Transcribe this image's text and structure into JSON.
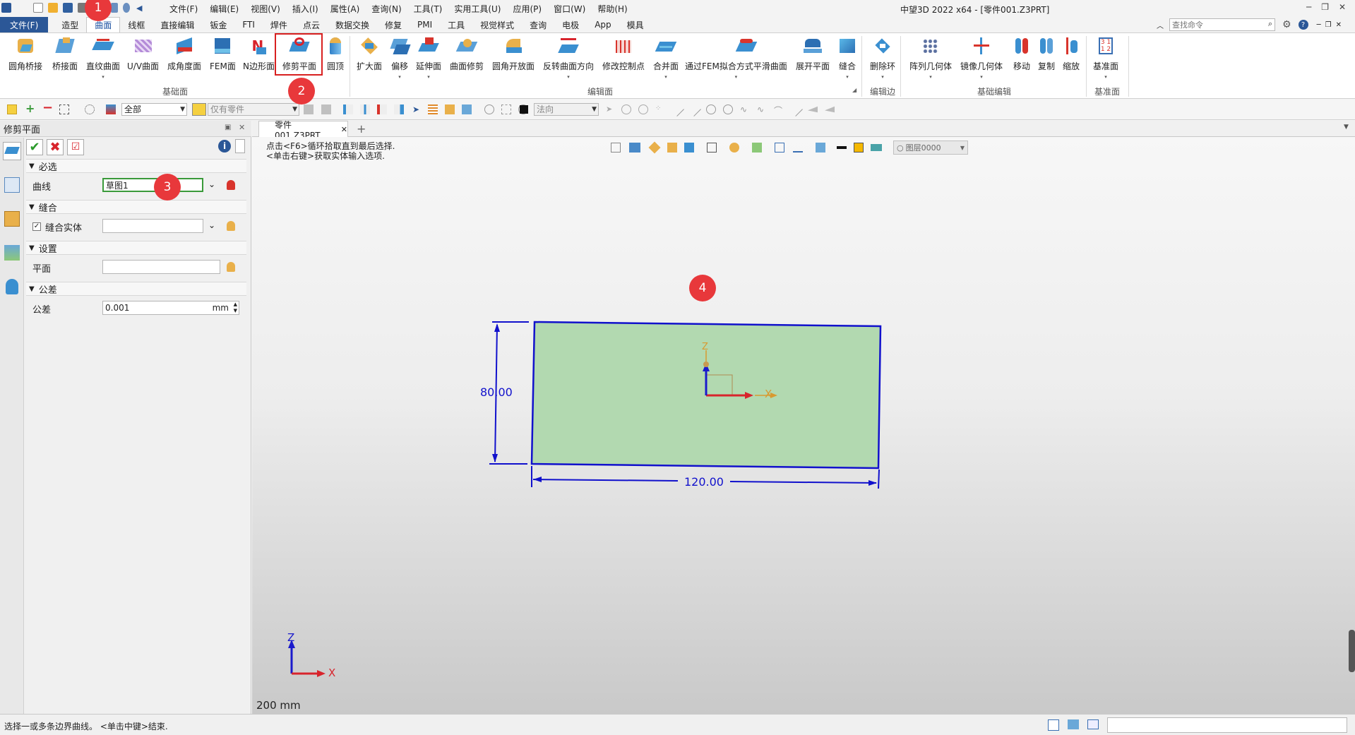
{
  "title": {
    "app": "中望3D 2022 x64 - [零件001.Z3PRT]",
    "menu": [
      "文件(F)",
      "编辑(E)",
      "视图(V)",
      "插入(I)",
      "属性(A)",
      "查询(N)",
      "工具(T)",
      "实用工具(U)",
      "应用(P)",
      "窗口(W)",
      "帮助(H)"
    ],
    "search_placeholder": "查找命令"
  },
  "ribbon_tabs": [
    "文件(F)",
    "造型",
    "曲面",
    "线框",
    "直接编辑",
    "钣金",
    "FTI",
    "焊件",
    "点云",
    "数据交换",
    "修复",
    "PMI",
    "工具",
    "视觉样式",
    "查询",
    "电极",
    "App",
    "模具"
  ],
  "ribbon": {
    "basic_surface": [
      "圆角桥接",
      "桥接面",
      "直纹曲面",
      "U/V曲面",
      "成角度面",
      "FEM面",
      "N边形面",
      "修剪平面",
      "圆顶"
    ],
    "basic_surface_label": "基础面",
    "edit_surface": [
      "扩大面",
      "偏移",
      "延伸面",
      "曲面修剪",
      "圆角开放面",
      "反转曲面方向",
      "修改控制点",
      "合并面",
      "通过FEM拟合方式平滑曲面",
      "展开平面",
      "缝合"
    ],
    "edit_surface_label": "编辑面",
    "edit_edge": [
      "删除环"
    ],
    "edit_edge_label": "编辑边",
    "basic_edit": [
      "阵列几何体",
      "镜像几何体",
      "移动",
      "复制",
      "缩放"
    ],
    "basic_edit_label": "基础编辑",
    "datum": [
      "基准面"
    ],
    "datum_label": "基准面"
  },
  "toolbar2": {
    "filter": "全部",
    "scope": "仅有零件",
    "normal": "法向"
  },
  "panel": {
    "title": "修剪平面",
    "section_required": "必选",
    "curve_label": "曲线",
    "curve_value": "草图1",
    "section_stitch": "缝合",
    "stitch_label": "缝合实体",
    "stitch_value": "",
    "section_settings": "设置",
    "plane_label": "平面",
    "plane_value": "",
    "section_tolerance": "公差",
    "tol_label": "公差",
    "tol_value": "0.001",
    "tol_unit": "mm"
  },
  "doc_tab": "零件001.Z3PRT",
  "hint_line1": "点击<F6>循环拾取直到最后选择.",
  "hint_line2": "<单击右键>获取实体输入选项.",
  "layer": "图层0000",
  "dims": {
    "height": "80.00",
    "width": "120.00"
  },
  "axes": {
    "x": "X",
    "z": "Z"
  },
  "scale": "200 mm",
  "status_text": "选择一或多条边界曲线。 <单击中键>结束.",
  "badges": [
    "1",
    "2",
    "3",
    "4"
  ],
  "colors": {
    "accent": "#2b5797",
    "dim": "#1111cc",
    "fill": "#b2d9b0",
    "badge": "#e8383b"
  }
}
